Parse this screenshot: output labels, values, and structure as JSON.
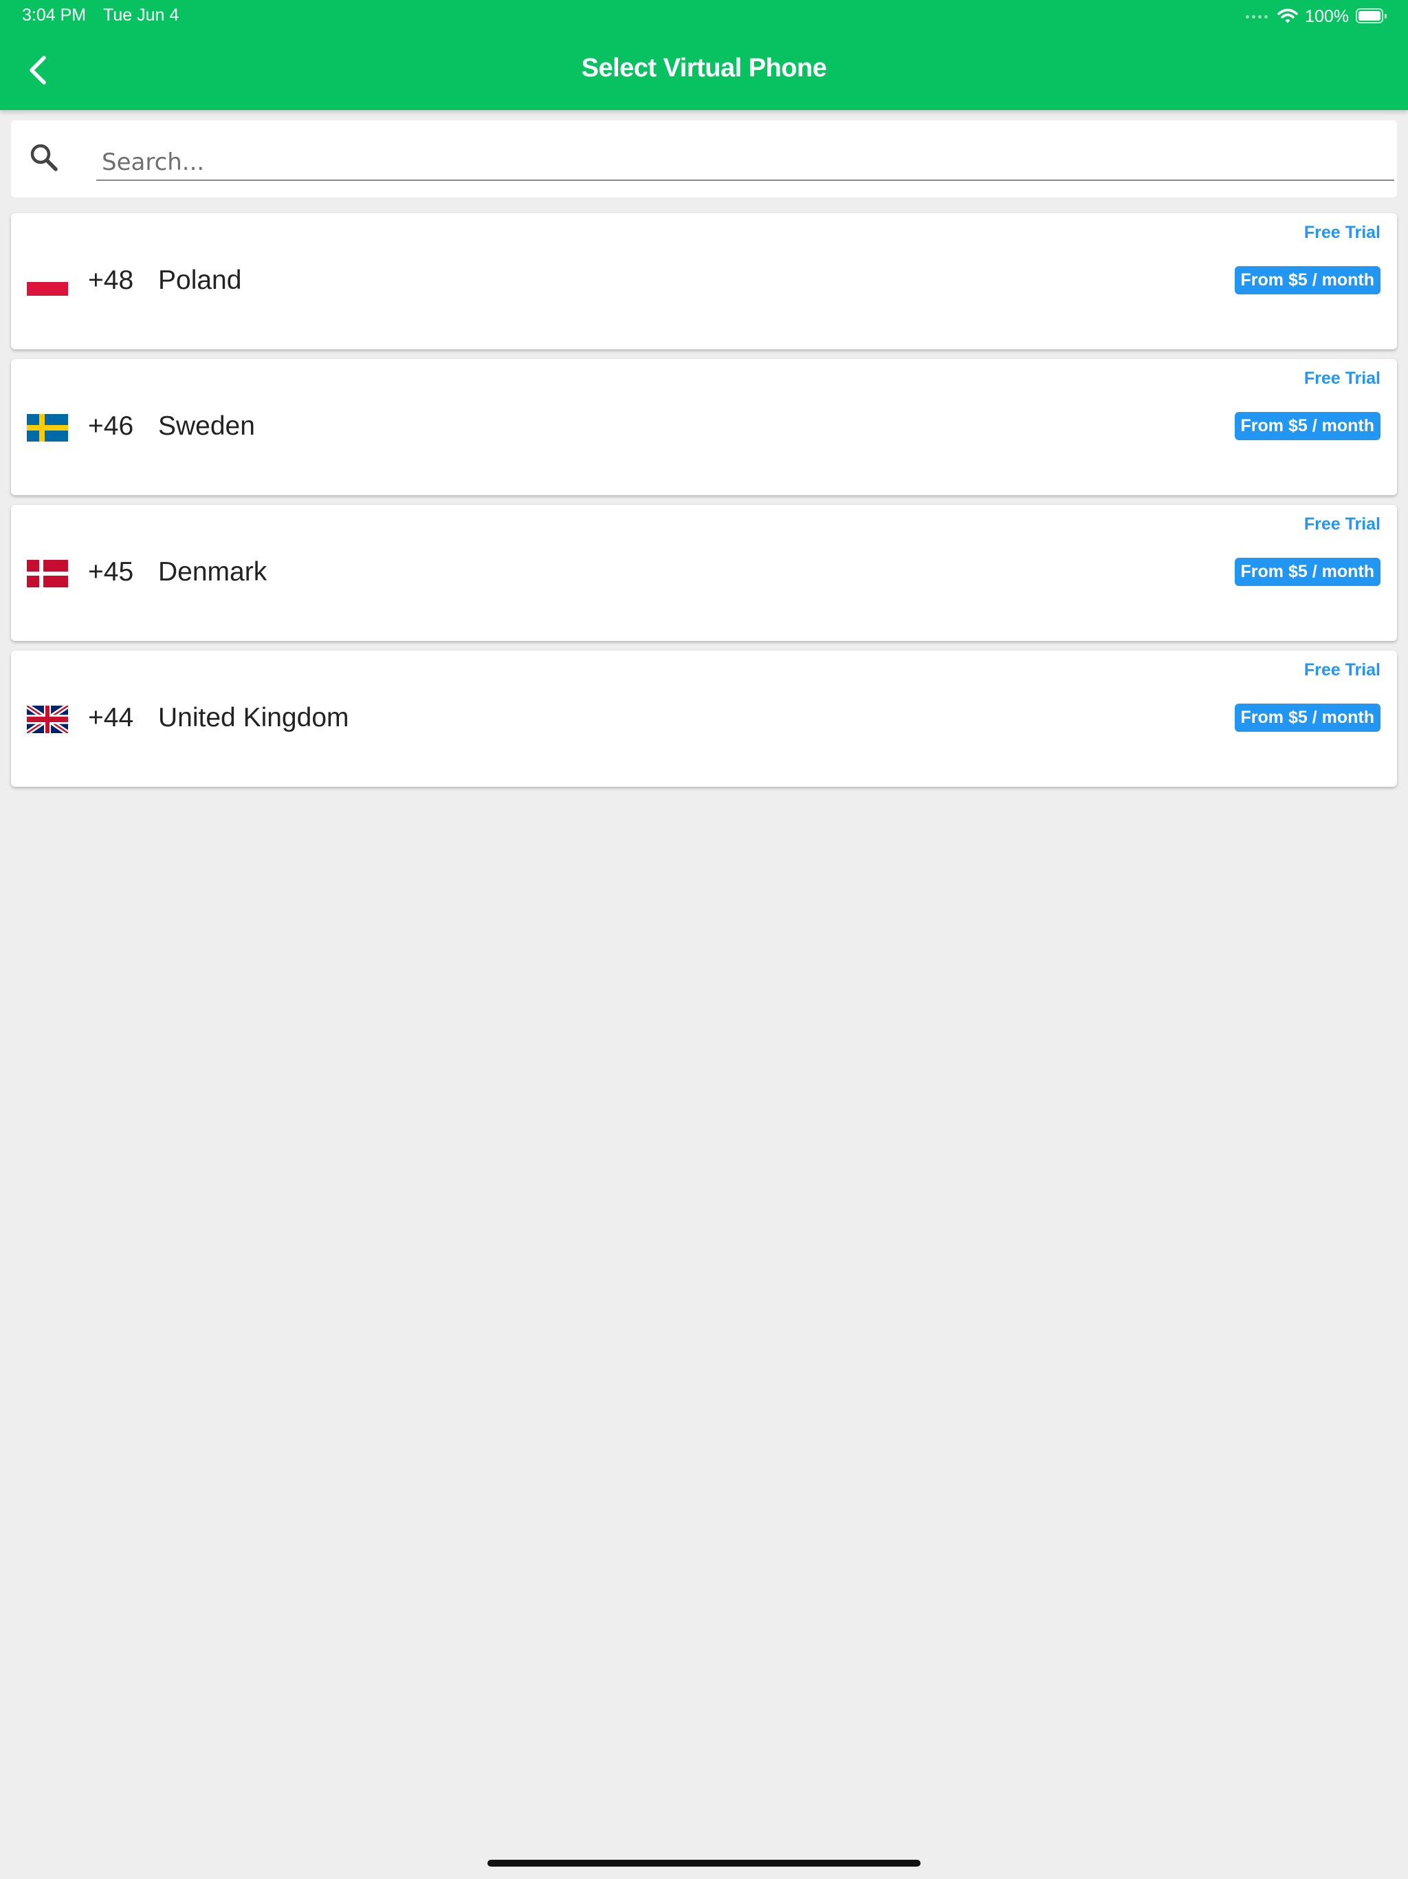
{
  "status_bar": {
    "time": "3:04 PM",
    "date": "Tue Jun 4",
    "battery": "100%",
    "wifi_icon": "wifi-icon",
    "battery_icon": "battery-icon"
  },
  "app_bar": {
    "title": "Select Virtual Phone",
    "back_icon": "chevron-left-icon",
    "color": "#08c160"
  },
  "search": {
    "placeholder": "Search...",
    "value": "",
    "icon": "search-icon"
  },
  "accent_color": "#2196f3",
  "countries": [
    {
      "code": "+48",
      "name": "Poland",
      "free_trial": "Free Trial",
      "price": "From $5 / month",
      "flag": "poland-flag-icon"
    },
    {
      "code": "+46",
      "name": "Sweden",
      "free_trial": "Free Trial",
      "price": "From $5 / month",
      "flag": "sweden-flag-icon"
    },
    {
      "code": "+45",
      "name": "Denmark",
      "free_trial": "Free Trial",
      "price": "From $5 / month",
      "flag": "denmark-flag-icon"
    },
    {
      "code": "+44",
      "name": "United Kingdom",
      "free_trial": "Free Trial",
      "price": "From $5 / month",
      "flag": "uk-flag-icon"
    }
  ]
}
